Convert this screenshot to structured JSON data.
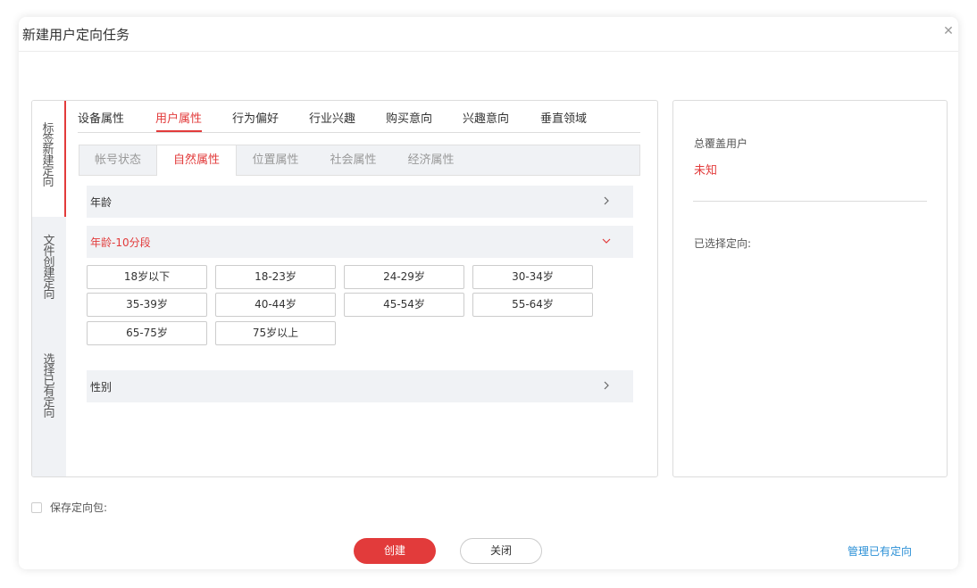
{
  "dialog": {
    "title": "新建用户定向任务",
    "close_icon": "close-icon"
  },
  "vertical_tabs": [
    {
      "label": "标签新建定向",
      "active": true
    },
    {
      "label": "文件创建定向",
      "active": false
    },
    {
      "label": "选择已有定向",
      "active": false
    }
  ],
  "primary_tabs": [
    {
      "label": "设备属性",
      "active": false
    },
    {
      "label": "用户属性",
      "active": true
    },
    {
      "label": "行为偏好",
      "active": false
    },
    {
      "label": "行业兴趣",
      "active": false
    },
    {
      "label": "购买意向",
      "active": false
    },
    {
      "label": "兴趣意向",
      "active": false
    },
    {
      "label": "垂直领域",
      "active": false
    }
  ],
  "secondary_tabs": [
    {
      "label": "帐号状态",
      "active": false
    },
    {
      "label": "自然属性",
      "active": true
    },
    {
      "label": "位置属性",
      "active": false
    },
    {
      "label": "社会属性",
      "active": false
    },
    {
      "label": "经济属性",
      "active": false
    }
  ],
  "sections": {
    "age": {
      "label": "年龄",
      "icon": "chevron-right-icon",
      "expanded": false
    },
    "age10": {
      "label": "年龄-10分段",
      "icon": "chevron-down-icon",
      "expanded": true,
      "options": [
        "18岁以下",
        "18-23岁",
        "24-29岁",
        "30-34岁",
        "35-39岁",
        "40-44岁",
        "45-54岁",
        "55-64岁",
        "65-75岁",
        "75岁以上"
      ]
    },
    "gender": {
      "label": "性别",
      "icon": "chevron-right-icon",
      "expanded": false
    }
  },
  "summary": {
    "coverage_label": "总覆盖用户",
    "coverage_value": "未知",
    "selected_label": "已选择定向:"
  },
  "footer": {
    "save_package_label": "保存定向包:",
    "create_button": "创建",
    "close_button": "关闭",
    "manage_link": "管理已有定向"
  },
  "colors": {
    "accent": "#e23b3b",
    "link": "#2a8fd6",
    "panel_bg": "#f0f2f5"
  }
}
